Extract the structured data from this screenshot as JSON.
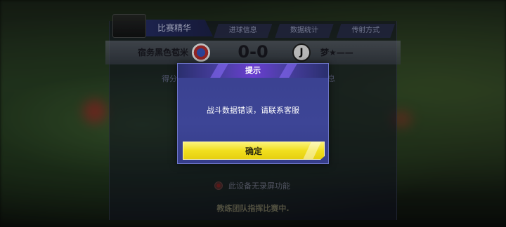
{
  "header": {
    "highlights_tab": "比赛精华",
    "subtabs": [
      "进球信息",
      "数据统计",
      "传射方式"
    ]
  },
  "match": {
    "home_team": "宿务黑色苞米",
    "score": "0-0",
    "away_team": "梦★——",
    "away_logo_glyph": "J",
    "stat_left": "得分",
    "stat_right": "息"
  },
  "background": {
    "no_record_text": "此设备无录屏功能",
    "coach_text": "教练团队指挥比赛中."
  },
  "dialog": {
    "title": "提示",
    "message": "战斗数据错误，请联系客服",
    "confirm_label": "确定"
  },
  "colors": {
    "dialog_bg": "#3d4596",
    "dialog_header": "#6a3ed0",
    "confirm_button": "#f1df1e"
  }
}
